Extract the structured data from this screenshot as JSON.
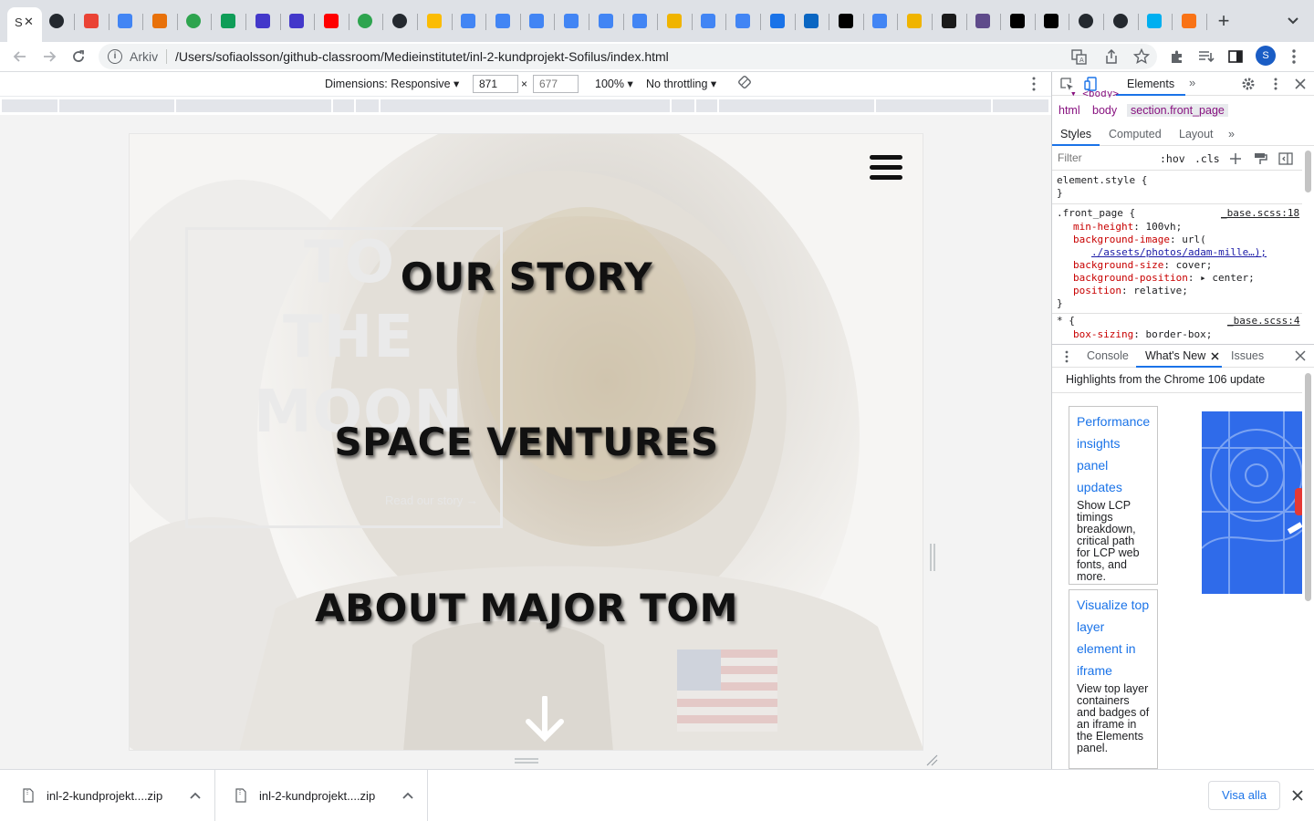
{
  "browser": {
    "active_tab": {
      "title": "S",
      "close_glyph": "✕"
    },
    "pinned_tabs": [
      {
        "icon": "github-icon",
        "color": "#24292f"
      },
      {
        "icon": "maps-pin-icon",
        "color": "#ea4335"
      },
      {
        "icon": "google-docs-icon",
        "color": "#4285f4"
      },
      {
        "icon": "code-brackets-icon",
        "color": "#e8710a"
      },
      {
        "icon": "github-classroom-icon",
        "color": "#2ea44f"
      },
      {
        "icon": "google-sheets-icon",
        "color": "#0f9d58"
      },
      {
        "icon": "powershell-icon",
        "color": "#4338ca"
      },
      {
        "icon": "powershell-icon",
        "color": "#4338ca"
      },
      {
        "icon": "youtube-icon",
        "color": "#ff0000"
      },
      {
        "icon": "github-classroom-icon",
        "color": "#2ea44f"
      },
      {
        "icon": "github-icon",
        "color": "#24292f"
      },
      {
        "icon": "google-drive-icon",
        "color": "#fbbc04"
      },
      {
        "icon": "google-docs-icon",
        "color": "#4285f4"
      },
      {
        "icon": "google-docs-icon",
        "color": "#4285f4"
      },
      {
        "icon": "google-docs-icon",
        "color": "#4285f4"
      },
      {
        "icon": "google-docs-icon",
        "color": "#4285f4"
      },
      {
        "icon": "google-docs-icon",
        "color": "#4285f4"
      },
      {
        "icon": "google-docs-icon",
        "color": "#4285f4"
      },
      {
        "icon": "json-icon",
        "color": "#f0b400"
      },
      {
        "icon": "google-docs-icon",
        "color": "#4285f4"
      },
      {
        "icon": "google-docs-icon",
        "color": "#4285f4"
      },
      {
        "icon": "puzzle-square-icon",
        "color": "#1a73e8"
      },
      {
        "icon": "linkedin-icon",
        "color": "#0a66c2"
      },
      {
        "icon": "medium-icon",
        "color": "#000000"
      },
      {
        "icon": "google-icon",
        "color": "#4285f4"
      },
      {
        "icon": "json-icon",
        "color": "#f0b400"
      },
      {
        "icon": "eraser-icon",
        "color": "#1a1a1a"
      },
      {
        "icon": "figma-plugin-icon",
        "color": "#5f4b8b"
      },
      {
        "icon": "medium-icon",
        "color": "#000000"
      },
      {
        "icon": "medium-icon",
        "color": "#000000"
      },
      {
        "icon": "github-icon",
        "color": "#24292f"
      },
      {
        "icon": "github-icon",
        "color": "#24292f"
      },
      {
        "icon": "skype-icon",
        "color": "#00aff0"
      },
      {
        "icon": "web-icon",
        "color": "#f97316"
      }
    ],
    "new_tab_glyph": "+",
    "address": {
      "scheme_label": "Arkiv",
      "url": "/Users/sofiaolsson/github-classroom/Medieinstitutet/inl-2-kundprojekt-Sofilus/index.html"
    },
    "profile_initial": "S"
  },
  "device_toolbar": {
    "dimensions_label": "Dimensions: Responsive ▾",
    "width": "871",
    "height_placeholder": "677",
    "times": "×",
    "zoom": "100% ▾",
    "throttling": "No throttling ▾"
  },
  "site": {
    "hero_box": {
      "line1": "TO",
      "line2": "THE",
      "line3": "MOON",
      "link": "Read our story →"
    },
    "nav_links": [
      "OUR STORY",
      "SPACE VENTURES",
      "ABOUT MAJOR TOM"
    ]
  },
  "devtools": {
    "panel_tab": "Elements",
    "more": "»",
    "truncated_body": "▾ <body>",
    "breadcrumbs": [
      "html",
      "body",
      "section.front_page"
    ],
    "style_tabs": [
      "Styles",
      "Computed",
      "Layout",
      "»"
    ],
    "filter_placeholder": "Filter",
    "hov": ":hov",
    "cls": ".cls",
    "element_style": {
      "selector": "element.style {",
      "close": "}"
    },
    "rule1": {
      "selector": ".front_page {",
      "source": "_base.scss:18",
      "decls": [
        {
          "prop": "min-height",
          "val": "100vh;"
        },
        {
          "prop": "background-image",
          "val": "url("
        },
        {
          "prop": "",
          "val": "./assets/photos/adam-mille…);"
        },
        {
          "prop": "background-size",
          "val": "cover;"
        },
        {
          "prop": "background-position",
          "val": "▸ center;"
        },
        {
          "prop": "position",
          "val": "relative;"
        }
      ],
      "close": "}"
    },
    "rule2": {
      "selector": "* {",
      "source": "_base.scss:4",
      "decls": [
        {
          "prop": "box-sizing",
          "val": "border-box;"
        }
      ]
    },
    "drawer_tabs": [
      "Console",
      "What's New",
      "Issues"
    ],
    "whats_new_heading": "Highlights from the Chrome 106 update",
    "cards": [
      {
        "title": "Performance insights panel updates",
        "desc": "Show LCP timings breakdown, critical path for LCP web fonts, and more."
      },
      {
        "title": "Visualize top layer element in iframe",
        "desc": "View top layer containers and badges of an iframe in the Elements panel."
      }
    ]
  },
  "downloads": {
    "items": [
      "inl-2-kundprojekt....zip",
      "inl-2-kundprojekt....zip"
    ],
    "show_all": "Visa alla"
  }
}
